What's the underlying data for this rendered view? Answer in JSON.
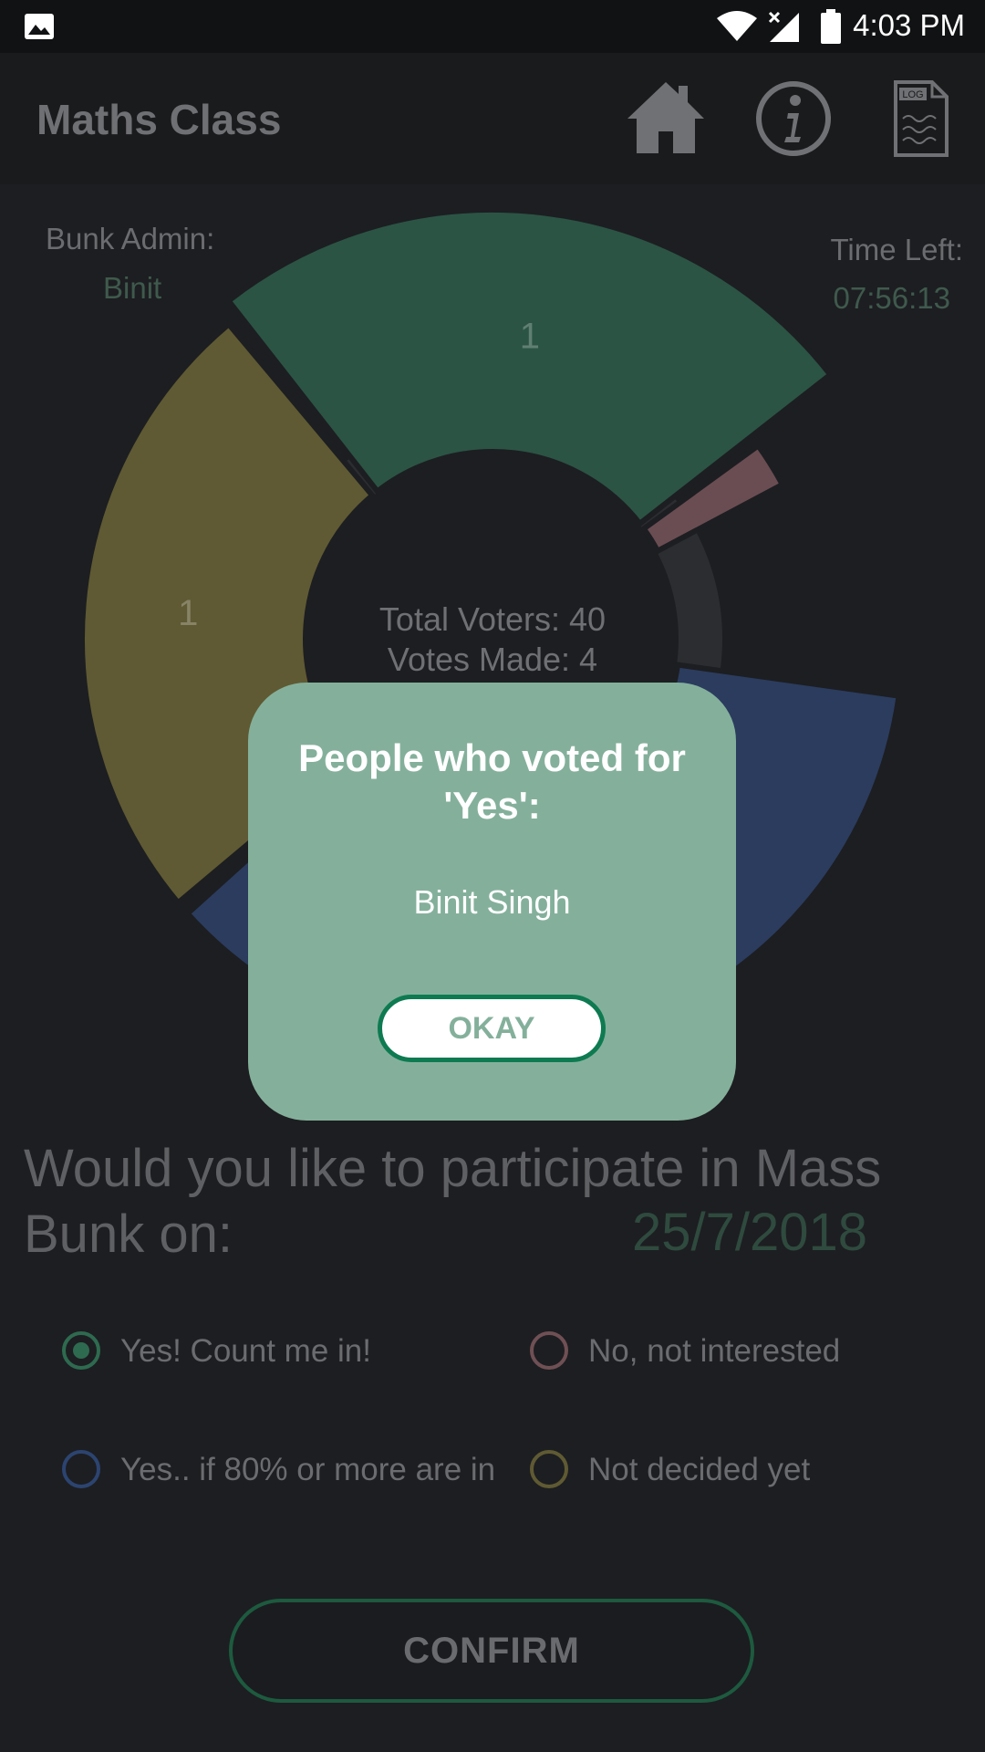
{
  "status_bar": {
    "time": "4:03 PM",
    "icons": [
      "image-icon",
      "wifi-icon",
      "no-signal-icon",
      "battery-icon"
    ]
  },
  "app_bar": {
    "title": "Maths Class",
    "actions": [
      "home-icon",
      "info-icon",
      "log-file-icon"
    ],
    "log_icon_text": "LOG"
  },
  "admin": {
    "label": "Bunk Admin:",
    "name": "Binit"
  },
  "timer": {
    "label": "Time Left:",
    "value": "07:56:13"
  },
  "chart_data": {
    "type": "pie",
    "donut": true,
    "slices": [
      {
        "label": "Not decided yet",
        "value": 1,
        "color": "#5f5a33",
        "data_label": "1"
      },
      {
        "label": "Yes! Count me in!",
        "value": 1,
        "color": "#2b5444",
        "data_label": "1"
      },
      {
        "label": "No, not interested",
        "value": 1,
        "color": "#6a4d52",
        "data_label": ""
      },
      {
        "label": "Yes.. if 80% or more are in",
        "value": 1,
        "color": "#2b3c5e",
        "data_label": "1"
      }
    ],
    "center_lines": [
      "Total Voters: 40",
      "Votes Made: 4"
    ]
  },
  "question": {
    "text": "Would you like to participate in Mass Bunk on:",
    "date": "25/7/2018"
  },
  "options": [
    {
      "label": "Yes! Count me in!",
      "color": "#2e6a50",
      "selected": true
    },
    {
      "label": "No, not interested",
      "color": "#6f5055",
      "selected": false
    },
    {
      "label": "Yes.. if 80% or more are in",
      "color": "#2c4470",
      "selected": false
    },
    {
      "label": "Not decided yet",
      "color": "#5f5a33",
      "selected": false
    }
  ],
  "confirm": {
    "label": "CONFIRM"
  },
  "dialog": {
    "title_line1": "People who voted for",
    "title_line2": "'Yes':",
    "voters": "Binit Singh",
    "ok_label": "OKAY"
  }
}
